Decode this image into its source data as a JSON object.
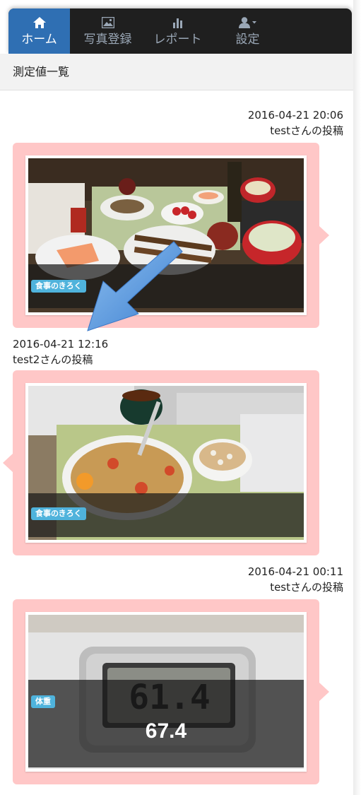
{
  "nav": {
    "items": [
      {
        "label": "ホーム",
        "icon": "home-icon",
        "active": true
      },
      {
        "label": "写真登録",
        "icon": "picture-icon",
        "active": false
      },
      {
        "label": "レポート",
        "icon": "bar-chart-icon",
        "active": false
      },
      {
        "label": "設定",
        "icon": "user-icon",
        "active": false
      }
    ],
    "active_color": "#2f6fb3"
  },
  "breadcrumb": {
    "title": "測定値一覧"
  },
  "posts": [
    {
      "datetime": "2016-04-21 20:06",
      "author": "testさんの投稿",
      "badge": "食事のきろく",
      "value": "",
      "align": "right"
    },
    {
      "datetime": "2016-04-21 12:16",
      "author": "test2さんの投稿",
      "badge": "食事のきろく",
      "value": "",
      "align": "left"
    },
    {
      "datetime": "2016-04-21 00:11",
      "author": "testさんの投稿",
      "badge": "体重",
      "value": "67.4",
      "align": "right"
    }
  ],
  "colors": {
    "card_bg": "#ffc7c7",
    "badge_bg": "#4fb3dc",
    "arrow": "#4a90d9"
  }
}
